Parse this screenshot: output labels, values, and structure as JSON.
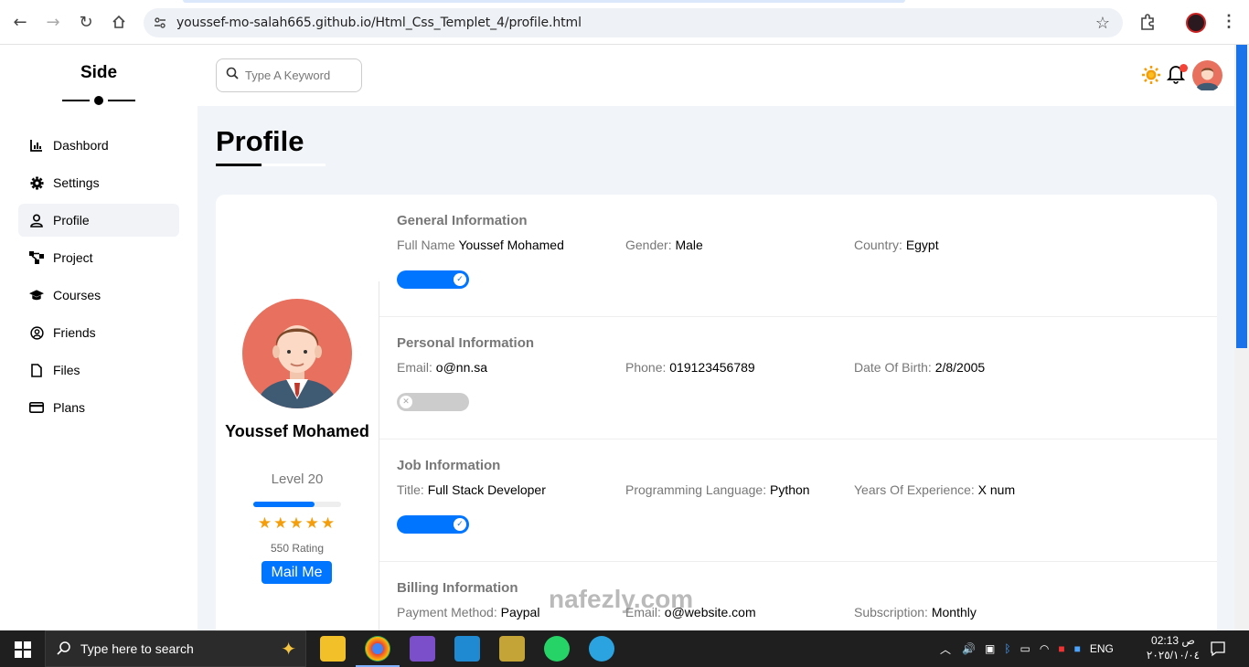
{
  "browser": {
    "url": "youssef-mo-salah665.github.io/Html_Css_Templet_4/profile.html"
  },
  "sidebar": {
    "title": "Side",
    "items": [
      {
        "label": "Dashbord",
        "icon": "chart-icon"
      },
      {
        "label": "Settings",
        "icon": "gear-icon"
      },
      {
        "label": "Profile",
        "icon": "user-icon",
        "active": true
      },
      {
        "label": "Project",
        "icon": "diagram-icon"
      },
      {
        "label": "Courses",
        "icon": "graduation-cap-icon"
      },
      {
        "label": "Friends",
        "icon": "circle-user-icon"
      },
      {
        "label": "Files",
        "icon": "file-icon"
      },
      {
        "label": "Plans",
        "icon": "credit-card-icon"
      }
    ]
  },
  "topbar": {
    "search_placeholder": "Type A Keyword"
  },
  "page": {
    "title": "Profile"
  },
  "profile": {
    "name": "Youssef Mohamed",
    "level": "Level 20",
    "level_progress": 0.7,
    "stars": 5,
    "rating": "550 Rating",
    "mail_button": "Mail Me"
  },
  "sections": [
    {
      "title": "General Information",
      "toggle_on": true,
      "fields": [
        {
          "label": "Full Name",
          "value": "Youssef Mohamed"
        },
        {
          "label": "Gender:",
          "value": "Male"
        },
        {
          "label": "Country:",
          "value": "Egypt"
        }
      ]
    },
    {
      "title": "Personal Information",
      "toggle_on": false,
      "fields": [
        {
          "label": "Email:",
          "value": "o@nn.sa"
        },
        {
          "label": "Phone:",
          "value": "019123456789"
        },
        {
          "label": "Date Of Birth:",
          "value": "2/8/2005"
        }
      ]
    },
    {
      "title": "Job Information",
      "toggle_on": true,
      "fields": [
        {
          "label": "Title:",
          "value": "Full Stack Developer"
        },
        {
          "label": "Programming Language:",
          "value": "Python"
        },
        {
          "label": "Years Of Experience:",
          "value": "X num"
        }
      ]
    },
    {
      "title": "Billing Information",
      "fields": [
        {
          "label": "Payment Method:",
          "value": "Paypal"
        },
        {
          "label": "Email:",
          "value": "o@website.com"
        },
        {
          "label": "Subscription:",
          "value": "Monthly"
        }
      ]
    }
  ],
  "taskbar": {
    "search_text": "Type here to search",
    "language": "ENG",
    "time": "02:13 ص",
    "date": "٢٠٢٥/١٠/٠٤"
  },
  "watermark": "nafezly.com",
  "colors": {
    "accent": "#0075ff",
    "star": "#f59e0b",
    "muted_text": "#777777",
    "page_bg": "#f1f4f8"
  }
}
